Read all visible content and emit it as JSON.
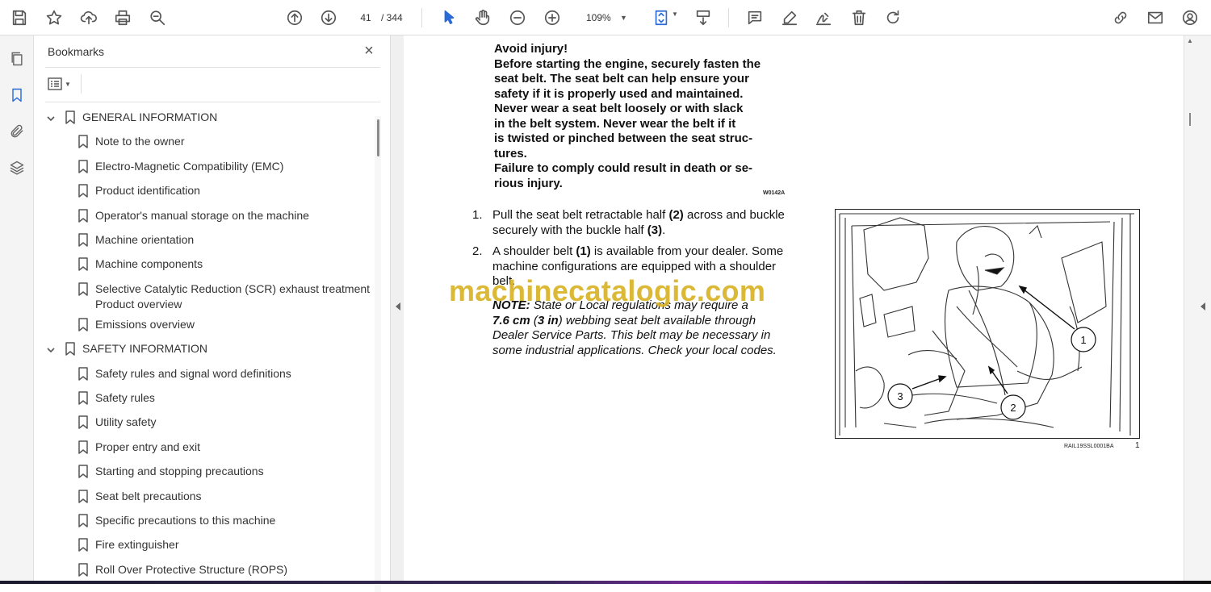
{
  "toolbar": {
    "page_current": "41",
    "page_total": "/ 344",
    "zoom": "109%",
    "icons": [
      "save-icon",
      "star-icon",
      "upload-icon",
      "print-icon",
      "zoom-search-icon",
      "page-up-icon",
      "page-down-icon",
      "select-cursor-icon",
      "hand-icon",
      "zoom-out-icon",
      "zoom-in-icon",
      "fit-page-icon",
      "scroll-mode-icon",
      "comment-icon",
      "highlight-pen-icon",
      "sign-icon",
      "delete-icon",
      "rotate-icon",
      "share-link-icon",
      "email-icon",
      "account-icon"
    ]
  },
  "leftrail": {
    "icons": [
      "pages-icon",
      "bookmarks-icon",
      "attachments-icon",
      "layers-icon"
    ]
  },
  "bookmarks": {
    "title": "Bookmarks",
    "close_label": "×",
    "items": [
      {
        "label": "GENERAL INFORMATION",
        "level": 0,
        "expanded": true
      },
      {
        "label": "Note to the owner",
        "level": 1
      },
      {
        "label": "Electro-Magnetic Compatibility (EMC)",
        "level": 1
      },
      {
        "label": "Product identification",
        "level": 1
      },
      {
        "label": "Operator's manual storage on the machine",
        "level": 1
      },
      {
        "label": "Machine orientation",
        "level": 1
      },
      {
        "label": "Machine components",
        "level": 1
      },
      {
        "label": "Selective Catalytic Reduction (SCR) exhaust treatment -",
        "label2": "Product overview",
        "level": 1
      },
      {
        "label": "Emissions overview",
        "level": 1
      },
      {
        "label": "SAFETY INFORMATION",
        "level": 0,
        "expanded": true
      },
      {
        "label": "Safety rules and signal word definitions",
        "level": 1
      },
      {
        "label": "Safety rules",
        "level": 1
      },
      {
        "label": "Utility safety",
        "level": 1
      },
      {
        "label": "Proper entry and exit",
        "level": 1
      },
      {
        "label": "Starting and stopping precautions",
        "level": 1
      },
      {
        "label": "Seat belt precautions",
        "level": 1
      },
      {
        "label": "Specific precautions to this machine",
        "level": 1
      },
      {
        "label": "Fire extinguisher",
        "level": 1
      },
      {
        "label": "Roll Over Protective Structure (ROPS)",
        "level": 1
      }
    ]
  },
  "document": {
    "warning_lines": [
      "Avoid injury!",
      "Before starting the engine, securely fasten the",
      "seat belt.  The seat belt can help ensure your",
      "safety if it is properly used and maintained.",
      "Never wear a seat belt loosely or with slack",
      "in the belt system.  Never wear the belt if it",
      "is twisted or pinched between the seat struc-",
      "tures.",
      "Failure to comply could result in death or se-",
      "rious injury."
    ],
    "warning_code": "W0142A",
    "step1_num": "1.",
    "step1_line1_a": "Pull the seat belt retractable half ",
    "step1_line1_b": "(2)",
    "step1_line1_c": " across and buckle",
    "step1_line2_a": "securely with the buckle half ",
    "step1_line2_b": "(3)",
    "step1_line2_c": ".",
    "step2_num": "2.",
    "step2_line1_a": "A shoulder belt ",
    "step2_line1_b": "(1)",
    "step2_line1_c": " is available from your dealer.  Some",
    "step2_line2": "machine configurations are equipped with a shoulder",
    "step2_line3": "belt.",
    "note_label": "NOTE:",
    "note_line1": " State  or  Local  regulations  may  require  a",
    "note_line2_a": "7.6 cm",
    "note_line2_b": " (",
    "note_line2_c": "3 in",
    "note_line2_d": ")  webbing  seat  belt  available  through",
    "note_line3": "Dealer Service Parts.  This belt may be necessary in",
    "note_line4": "some industrial applications.  Check your local codes.",
    "watermark": "machinecatalogic.com",
    "figure_callouts": [
      "1",
      "2",
      "3"
    ],
    "figure_code": "RAIL19SSL0001BA",
    "figure_number": "1"
  }
}
